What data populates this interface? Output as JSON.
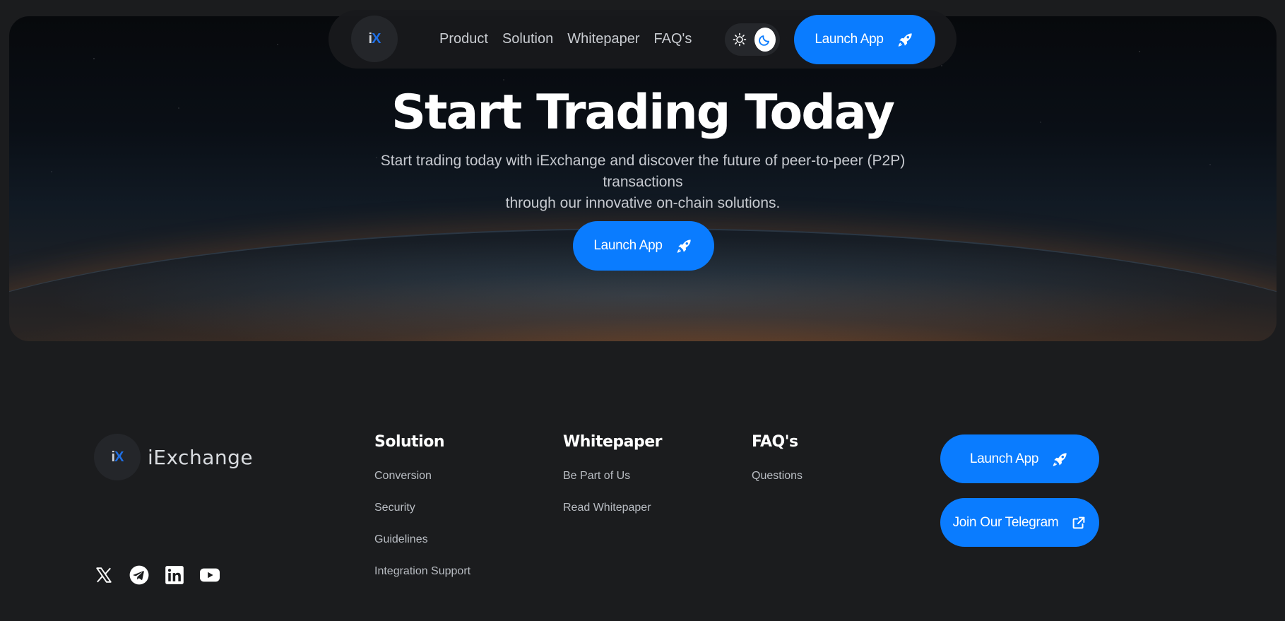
{
  "nav": {
    "logo_text": "iX",
    "links": [
      "Product",
      "Solution",
      "Whitepaper",
      "FAQ's"
    ],
    "launch_label": "Launch App"
  },
  "hero": {
    "title": "Start Trading Today",
    "subtitle_line1": "Start trading today with iExchange and discover the future of peer-to-peer (P2P) transactions",
    "subtitle_line2": "through our innovative on-chain solutions.",
    "cta_label": "Launch App"
  },
  "footer": {
    "brand": "iExchange",
    "columns": [
      {
        "title": "Solution",
        "links": [
          "Conversion",
          "Security",
          "Guidelines",
          "Integration Support"
        ]
      },
      {
        "title": "Whitepaper",
        "links": [
          "Be Part of Us",
          "Read Whitepaper"
        ]
      },
      {
        "title": "FAQ's",
        "links": [
          "Questions"
        ]
      }
    ],
    "launch_label": "Launch App",
    "telegram_label": "Join Our Telegram",
    "socials": [
      "x-icon",
      "telegram-icon",
      "linkedin-icon",
      "youtube-icon"
    ]
  },
  "colors": {
    "accent": "#0a7cff",
    "background": "#1b1c1e"
  }
}
